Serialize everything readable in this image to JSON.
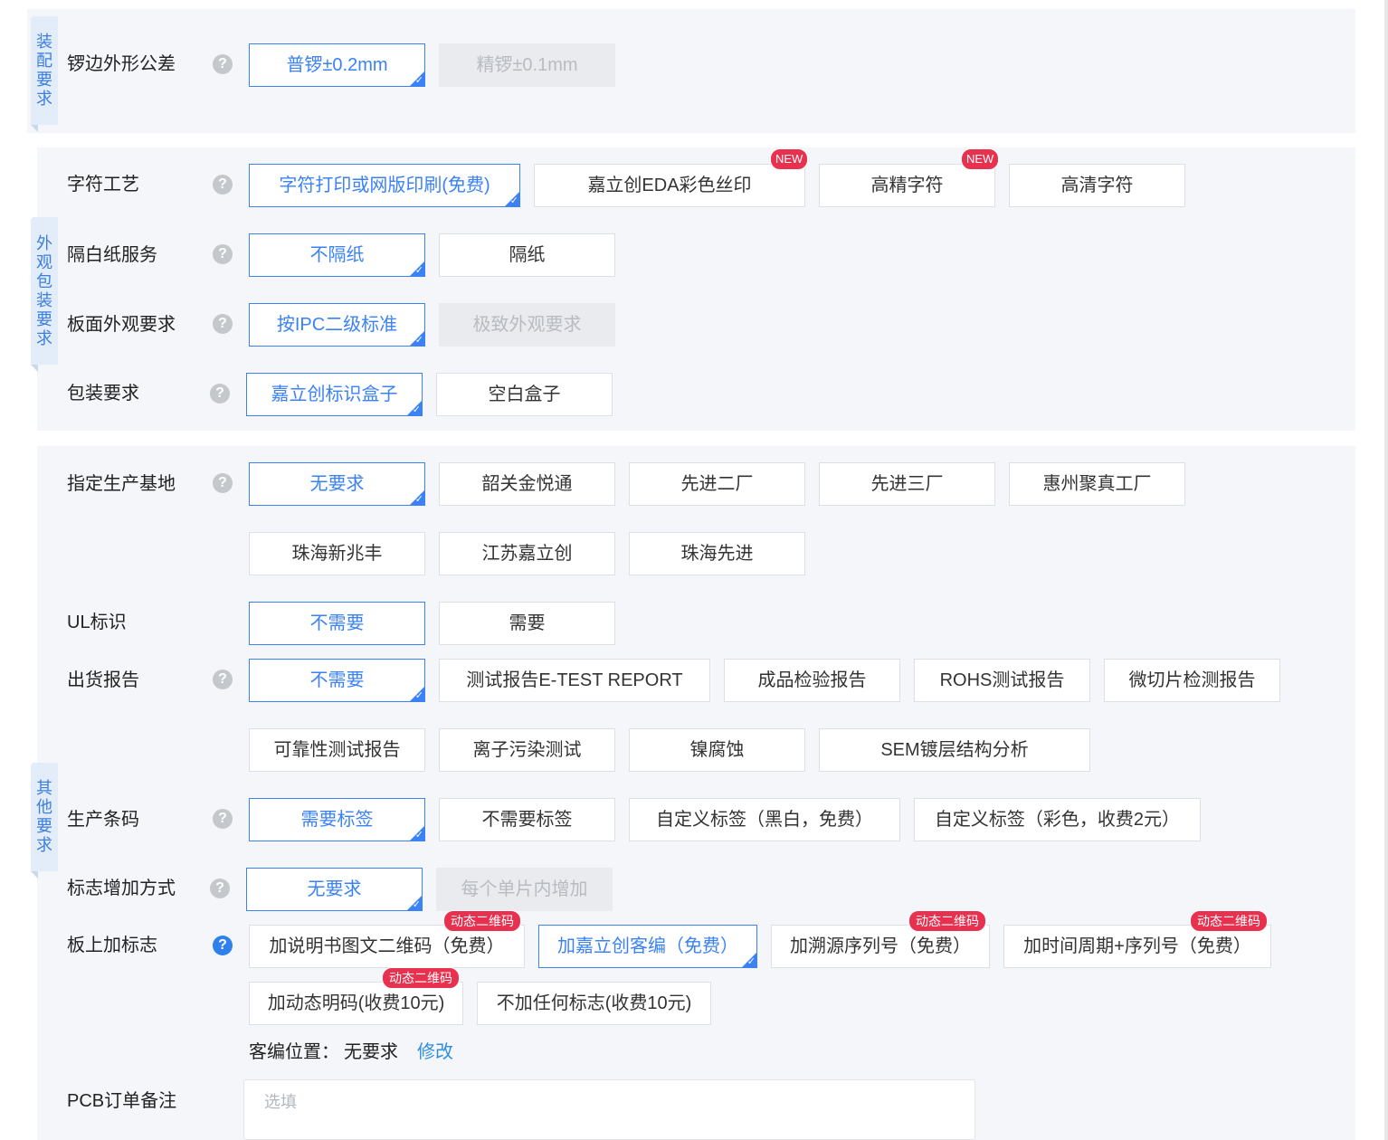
{
  "sections": {
    "assembly": "装配要求",
    "appearance": "外观包装要求",
    "other": "其他要求"
  },
  "rows": {
    "edge_tolerance": {
      "label": "锣边外形公差",
      "options": [
        "普锣±0.2mm",
        "精锣±0.1mm"
      ]
    },
    "silkscreen": {
      "label": "字符工艺",
      "options": [
        "字符打印或网版印刷(免费)",
        "嘉立创EDA彩色丝印",
        "高精字符",
        "高清字符"
      ],
      "new_badge": "NEW"
    },
    "separator": {
      "label": "隔白纸服务",
      "options": [
        "不隔纸",
        "隔纸"
      ]
    },
    "board_appearance": {
      "label": "板面外观要求",
      "options": [
        "按IPC二级标准",
        "极致外观要求"
      ]
    },
    "packaging": {
      "label": "包装要求",
      "options": [
        "嘉立创标识盒子",
        "空白盒子"
      ]
    },
    "factory": {
      "label": "指定生产基地",
      "options": [
        "无要求",
        "韶关金悦通",
        "先进二厂",
        "先进三厂",
        "惠州聚真工厂",
        "珠海新兆丰",
        "江苏嘉立创",
        "珠海先进"
      ]
    },
    "ul_mark": {
      "label": "UL标识",
      "options": [
        "不需要",
        "需要"
      ]
    },
    "shipping_report": {
      "label": "出货报告",
      "options": [
        "不需要",
        "测试报告E-TEST REPORT",
        "成品检验报告",
        "ROHS测试报告",
        "微切片检测报告",
        "可靠性测试报告",
        "离子污染测试",
        "镍腐蚀",
        "SEM镀层结构分析"
      ]
    },
    "barcode": {
      "label": "生产条码",
      "options": [
        "需要标签",
        "不需要标签",
        "自定义标签（黑白，免费）",
        "自定义标签（彩色，收费2元）"
      ]
    },
    "mark_method": {
      "label": "标志增加方式",
      "options": [
        "无要求",
        "每个单片内增加"
      ]
    },
    "board_mark": {
      "label": "板上加标志",
      "options": [
        "加说明书图文二维码（免费）",
        "加嘉立创客编（免费）",
        "加溯源序列号（免费）",
        "加时间周期+序列号（免费）",
        "加动态明码(收费10元)",
        "不加任何标志(收费10元)"
      ],
      "qr_badge": "动态二维码"
    },
    "customer_code": {
      "label": "客编位置：",
      "value": "无要求",
      "edit": "修改"
    },
    "remarks": {
      "label": "PCB订单备注",
      "placeholder": "选填"
    }
  },
  "icons": {
    "help": "question-circle-icon",
    "check": "checkmark-icon"
  },
  "colors": {
    "accent": "#3b82f6",
    "badge": "#e8304f",
    "panel": "#f4f6f9",
    "link": "#2f8ee0"
  }
}
